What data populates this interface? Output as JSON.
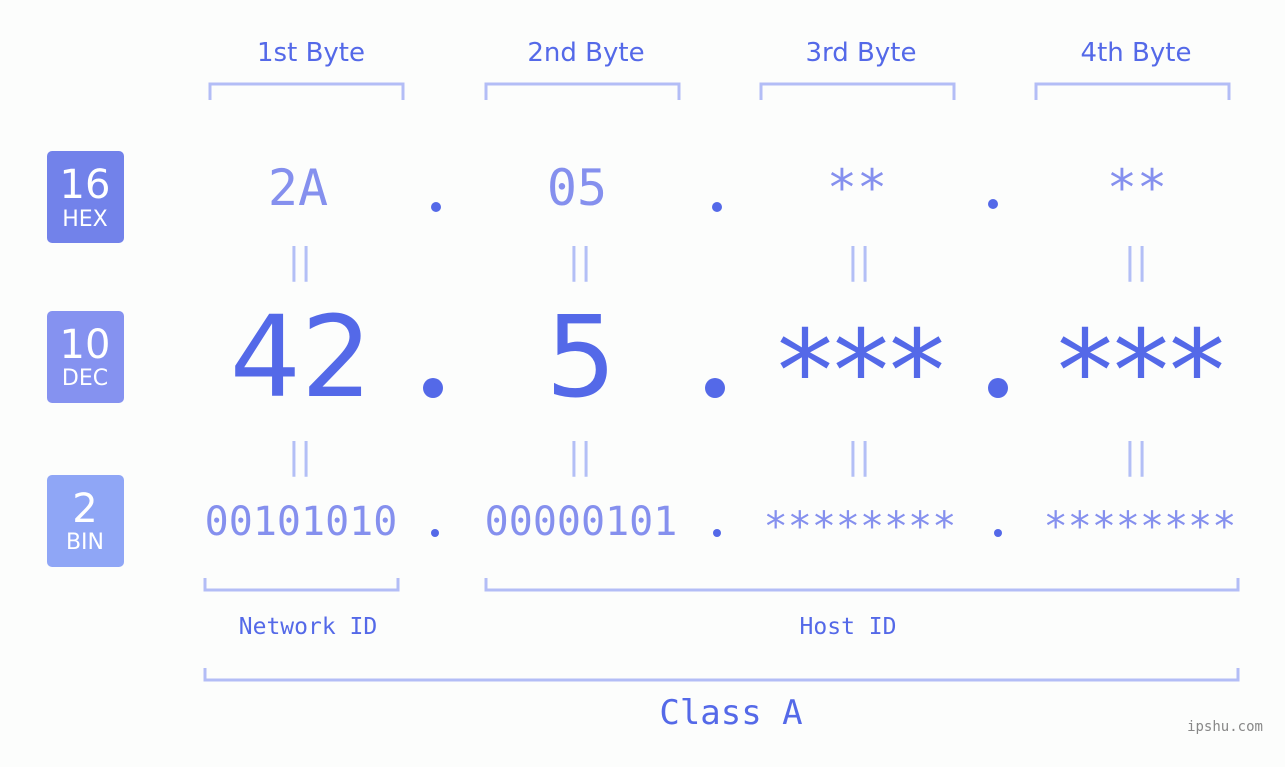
{
  "colors": {
    "background": "#fcfdfc",
    "primary": "#5469e8",
    "secondary": "#8590ee",
    "light": "#b3bdf6",
    "badge_hex": "#7282ea",
    "badge_dec": "#8592f0",
    "badge_bin": "#8fa6f6"
  },
  "byte_headers": [
    "1st Byte",
    "2nd Byte",
    "3rd Byte",
    "4th Byte"
  ],
  "badges": [
    {
      "base": "16",
      "label": "HEX"
    },
    {
      "base": "10",
      "label": "DEC"
    },
    {
      "base": "2",
      "label": "BIN"
    }
  ],
  "rows": {
    "hex": [
      "2A",
      "05",
      "**",
      "**"
    ],
    "dec": [
      "42",
      "5",
      "***",
      "***"
    ],
    "bin": [
      "00101010",
      "00000101",
      "********",
      "********"
    ]
  },
  "separator": ".",
  "equals_sign": "||",
  "segments": {
    "network": "Network ID",
    "host": "Host ID"
  },
  "ip_class": "Class A",
  "watermark": "ipshu.com"
}
